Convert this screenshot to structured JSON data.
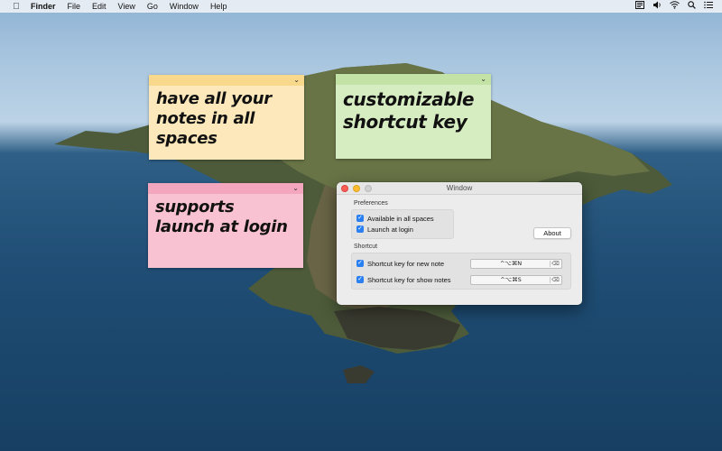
{
  "menubar": {
    "apple_icon": "apple-icon",
    "items": [
      "Finder",
      "File",
      "Edit",
      "View",
      "Go",
      "Window",
      "Help"
    ],
    "status_icons": [
      "notes-menu-icon",
      "volume-icon",
      "wifi-icon",
      "search-icon",
      "list-icon"
    ]
  },
  "notes": [
    {
      "text": "have all your notes in all spaces",
      "color": "#fde8bb"
    },
    {
      "text": "customizable shortcut key",
      "color": "#d6ecc1"
    },
    {
      "text": "supports launch at login",
      "color": "#f9c2d2"
    }
  ],
  "window": {
    "title": "Window",
    "preferences_label": "Preferences",
    "available_all_spaces": {
      "label": "Available in all spaces",
      "checked": true
    },
    "launch_at_login": {
      "label": "Launch at login",
      "checked": true
    },
    "about_button": "About",
    "shortcut_label": "Shortcut",
    "new_note_shortcut": {
      "label": "Shortcut key for new note",
      "checked": true,
      "keys": "^⌥⌘N"
    },
    "show_notes_shortcut": {
      "label": "Shortcut key for show notes",
      "checked": true,
      "keys": "^⌥⌘S"
    }
  },
  "colors": {
    "accent": "#2a7ff3",
    "close": "#fd5f57",
    "minimize": "#febc2e"
  }
}
